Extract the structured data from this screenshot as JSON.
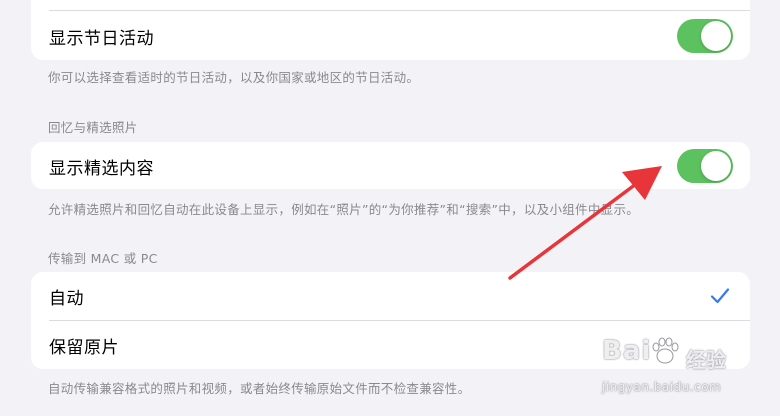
{
  "sections": {
    "holiday": {
      "row_label": "显示节日活动",
      "toggle_on": true,
      "footer": "你可以选择查看适时的节日活动，以及你国家或地区的节日活动。"
    },
    "featured": {
      "header": "回忆与精选照片",
      "row_label": "显示精选内容",
      "toggle_on": true,
      "footer": "允许精选照片和回忆自动在此设备上显示，例如在“照片”的“为你推荐”和“搜索”中，以及小组件中显示。"
    },
    "transfer": {
      "header": "传输到 MAC 或 PC",
      "options": [
        {
          "label": "自动",
          "selected": true
        },
        {
          "label": "保留原片",
          "selected": false
        }
      ],
      "footer": "自动传输兼容格式的照片和视频，或者始终传输原始文件而不检查兼容性。"
    }
  },
  "annotation": {
    "arrow_color": "#e8353a"
  },
  "watermark": {
    "brand": "Bai",
    "brand_suffix": "经验",
    "url": "jingyan.baidu.com"
  },
  "colors": {
    "background": "#f2f2f7",
    "toggle_on": "#5cc15f",
    "checkmark": "#3478f6",
    "secondary_text": "#8a8a8e"
  }
}
